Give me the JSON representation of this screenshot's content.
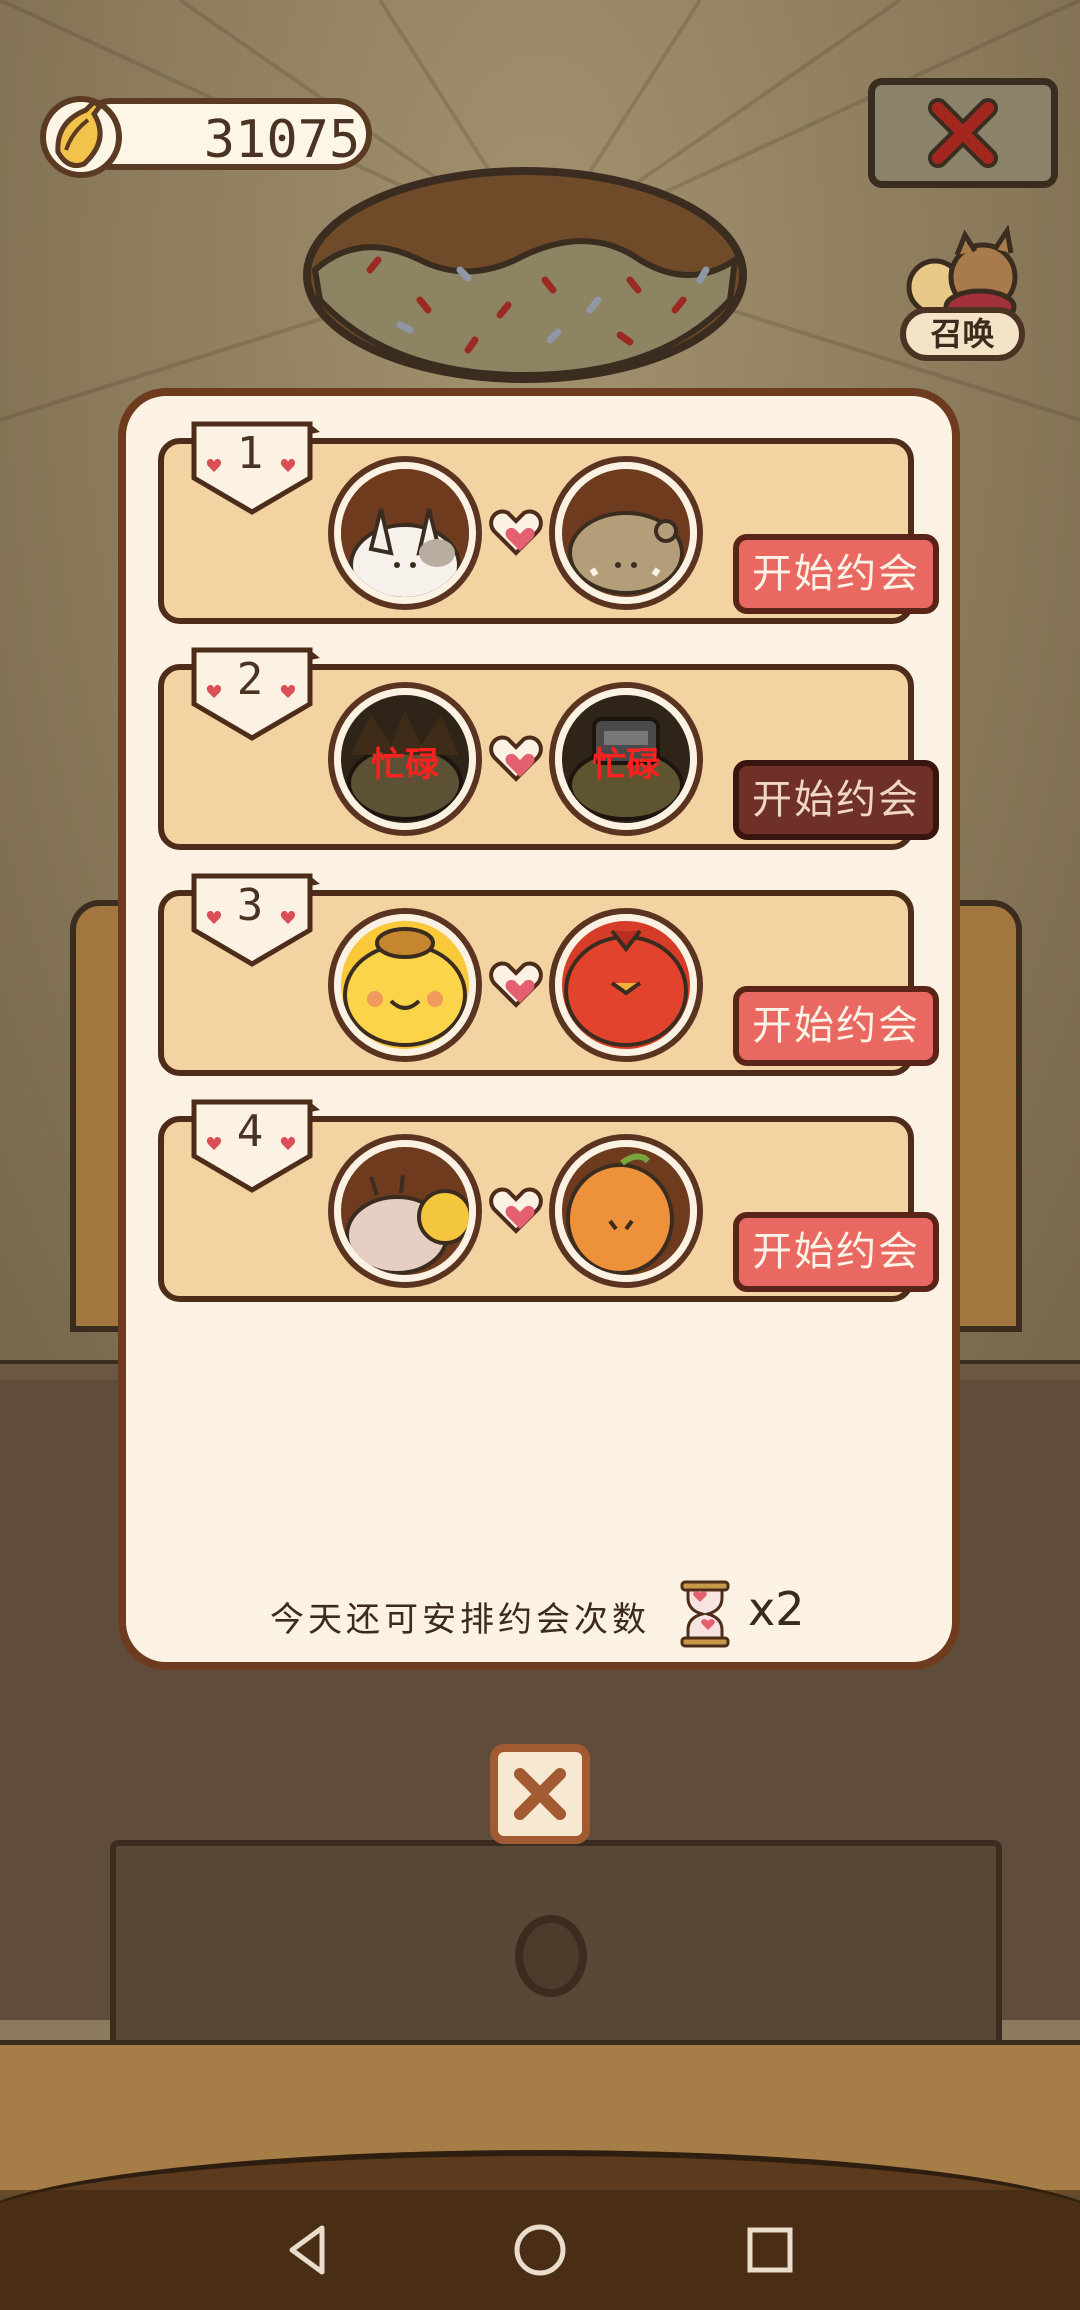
{
  "header": {
    "banana_count": "31075",
    "summon_label": "召唤"
  },
  "date_slots": [
    {
      "number": "1",
      "status": "available",
      "left_character": "white-bunny-character",
      "right_character": "brown-blob-character",
      "busy_label": "",
      "button_label": "开始约会"
    },
    {
      "number": "2",
      "status": "busy",
      "left_character": "spiky-hair-character",
      "right_character": "robot-character",
      "busy_label": "忙碌",
      "button_label": "开始约会"
    },
    {
      "number": "3",
      "status": "available",
      "left_character": "yellow-chick-character",
      "right_character": "red-bird-character",
      "busy_label": "",
      "button_label": "开始约会"
    },
    {
      "number": "4",
      "status": "available",
      "left_character": "snail-character",
      "right_character": "orange-fruit-character",
      "busy_label": "",
      "button_label": "开始约会"
    }
  ],
  "footer": {
    "remaining_text": "今天还可安排约会次数",
    "remaining_count": "x2"
  },
  "colors": {
    "panel_bg": "#fbf2e3",
    "slot_bg": "#f3d3a2",
    "button_active": "#ea6862",
    "button_disabled": "#6e3027",
    "busy_text": "#ff2020"
  },
  "icons": {
    "banana": "banana-icon",
    "close": "close-icon",
    "heart": "heart-icon",
    "hourglass": "hourglass-icon",
    "nav_back": "back-icon",
    "nav_home": "home-icon",
    "nav_recent": "recent-apps-icon"
  }
}
